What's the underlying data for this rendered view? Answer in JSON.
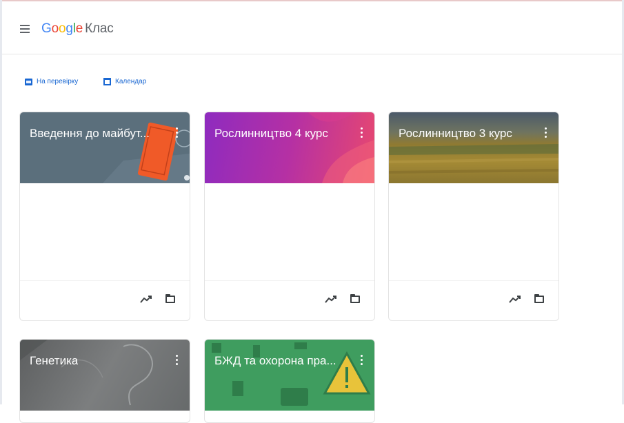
{
  "app": {
    "logo_letters": [
      "G",
      "o",
      "o",
      "g",
      "l",
      "e"
    ],
    "product": "Клас"
  },
  "quick_links": [
    {
      "label": "На перевірку",
      "icon": "todo-icon"
    },
    {
      "label": "Календар",
      "icon": "calendar-icon"
    }
  ],
  "colors": {
    "accent": "#1967d2",
    "intro_banner": "#5b6f7c",
    "plant4_banner": "#b530a4",
    "plant3_banner": "#8f7a32",
    "genetics_banner": "#6d6f70",
    "bzhd_banner": "#3f9d5f"
  },
  "classes": [
    {
      "title": "Введення до майбут...",
      "theme": "book-illustration"
    },
    {
      "title": "Рослинництво 4 курс",
      "theme": "pink-petals"
    },
    {
      "title": "Рослинництво 3 курс",
      "theme": "field-landscape"
    },
    {
      "title": "Генетика",
      "theme": "grey-sketch"
    },
    {
      "title": "БЖД та охорона пра...",
      "theme": "safety-icons"
    }
  ],
  "icons": {
    "menu": "hamburger-menu-icon",
    "more": "more-vert-icon",
    "progress": "trending-up-icon",
    "drive": "folder-icon"
  }
}
